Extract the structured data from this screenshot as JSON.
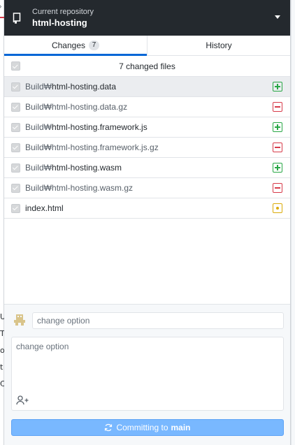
{
  "background": {
    "fragments": [
      "U",
      "T",
      "o",
      "t",
      "C"
    ]
  },
  "repo": {
    "caption": "Current repository",
    "name": "html-hosting"
  },
  "tabs": [
    {
      "label": "Changes",
      "count": "7",
      "active": true
    },
    {
      "label": "History",
      "active": false
    }
  ],
  "files": {
    "summary": "7 changed files",
    "items": [
      {
        "dir": "Build₩",
        "name": "html-hosting.data",
        "status": "added",
        "icon": "file-added-icon",
        "selected": true
      },
      {
        "dir": "Build₩",
        "name": "html-hosting.data.gz",
        "status": "deleted",
        "icon": "file-deleted-icon",
        "selected": false
      },
      {
        "dir": "Build₩",
        "name": "html-hosting.framework.js",
        "status": "added",
        "icon": "file-added-icon",
        "selected": false
      },
      {
        "dir": "Build₩",
        "name": "html-hosting.framework.js.gz",
        "status": "deleted",
        "icon": "file-deleted-icon",
        "selected": false
      },
      {
        "dir": "Build₩",
        "name": "html-hosting.wasm",
        "status": "added",
        "icon": "file-added-icon",
        "selected": false
      },
      {
        "dir": "Build₩",
        "name": "html-hosting.wasm.gz",
        "status": "deleted",
        "icon": "file-deleted-icon",
        "selected": false
      },
      {
        "dir": "",
        "name": "index.html",
        "status": "modified",
        "icon": "file-modified-icon",
        "selected": false
      }
    ]
  },
  "commit": {
    "summary_placeholder": "change option",
    "description_placeholder": "change option",
    "button_prefix": "Committing to",
    "branch": "main"
  },
  "colors": {
    "header_bg": "#24292e",
    "accent": "#0366d6",
    "added": "#28a745",
    "deleted": "#d73a49",
    "modified": "#dbab09",
    "commit_button": "#79b8ff"
  }
}
